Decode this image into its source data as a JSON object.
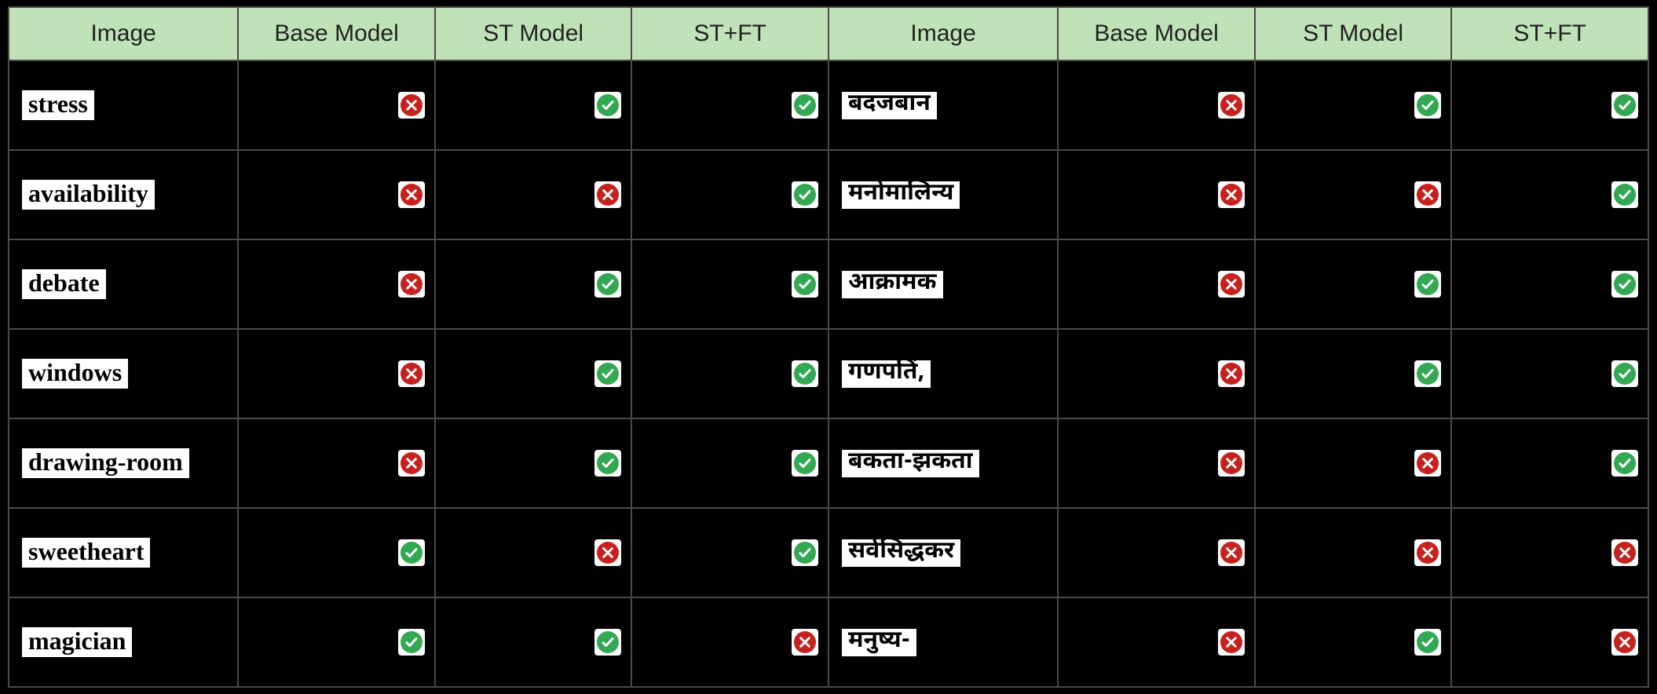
{
  "headers": {
    "image": "Image",
    "base": "Base Model",
    "st": "ST Model",
    "stft": "ST+FT"
  },
  "left_rows": [
    {
      "word": "stress",
      "results": [
        "wrong",
        "correct",
        "correct"
      ]
    },
    {
      "word": "availability",
      "results": [
        "wrong",
        "wrong",
        "correct"
      ]
    },
    {
      "word": "debate",
      "results": [
        "wrong",
        "correct",
        "correct"
      ]
    },
    {
      "word": "windows",
      "results": [
        "wrong",
        "correct",
        "correct"
      ]
    },
    {
      "word": "drawing-room",
      "results": [
        "wrong",
        "correct",
        "correct"
      ]
    },
    {
      "word": "sweetheart",
      "results": [
        "correct",
        "wrong",
        "correct"
      ]
    },
    {
      "word": "magician",
      "results": [
        "correct",
        "correct",
        "wrong"
      ]
    }
  ],
  "right_rows": [
    {
      "word": "बदजबान",
      "results": [
        "wrong",
        "correct",
        "correct"
      ]
    },
    {
      "word": "मनोमालिन्य",
      "results": [
        "wrong",
        "wrong",
        "correct"
      ]
    },
    {
      "word": "आक्रामक",
      "results": [
        "wrong",
        "correct",
        "correct"
      ]
    },
    {
      "word": "गणपतिं,",
      "results": [
        "wrong",
        "correct",
        "correct"
      ]
    },
    {
      "word": "बकता-झकता",
      "results": [
        "wrong",
        "wrong",
        "correct"
      ]
    },
    {
      "word": "सर्वसिद्धकर",
      "results": [
        "wrong",
        "wrong",
        "wrong"
      ]
    },
    {
      "word": "मनुष्य-",
      "results": [
        "wrong",
        "correct",
        "wrong"
      ]
    }
  ]
}
